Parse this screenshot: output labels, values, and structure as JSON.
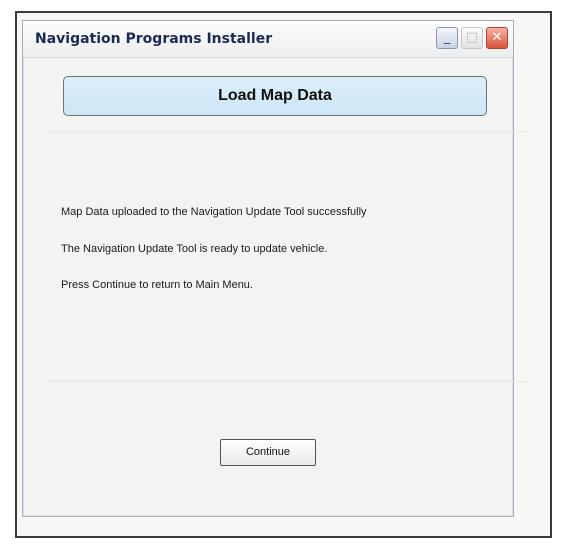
{
  "window": {
    "title": "Navigation Programs Installer",
    "controls": {
      "minimize_glyph": "_",
      "maximize_glyph": "□",
      "close_glyph": "✕"
    }
  },
  "main": {
    "header_label": "Load Map Data",
    "messages": [
      "Map Data uploaded to the Navigation Update Tool successfully",
      "The Navigation Update Tool is ready to update vehicle.",
      "Press Continue to return to Main Menu."
    ],
    "continue_label": "Continue"
  },
  "icons": {
    "minimize": "minimize-icon",
    "maximize": "maximize-icon",
    "close": "close-icon"
  },
  "colors": {
    "title_text": "#1d2a55",
    "header_fill": "#d6ebf8",
    "close_button": "#d9533a"
  }
}
